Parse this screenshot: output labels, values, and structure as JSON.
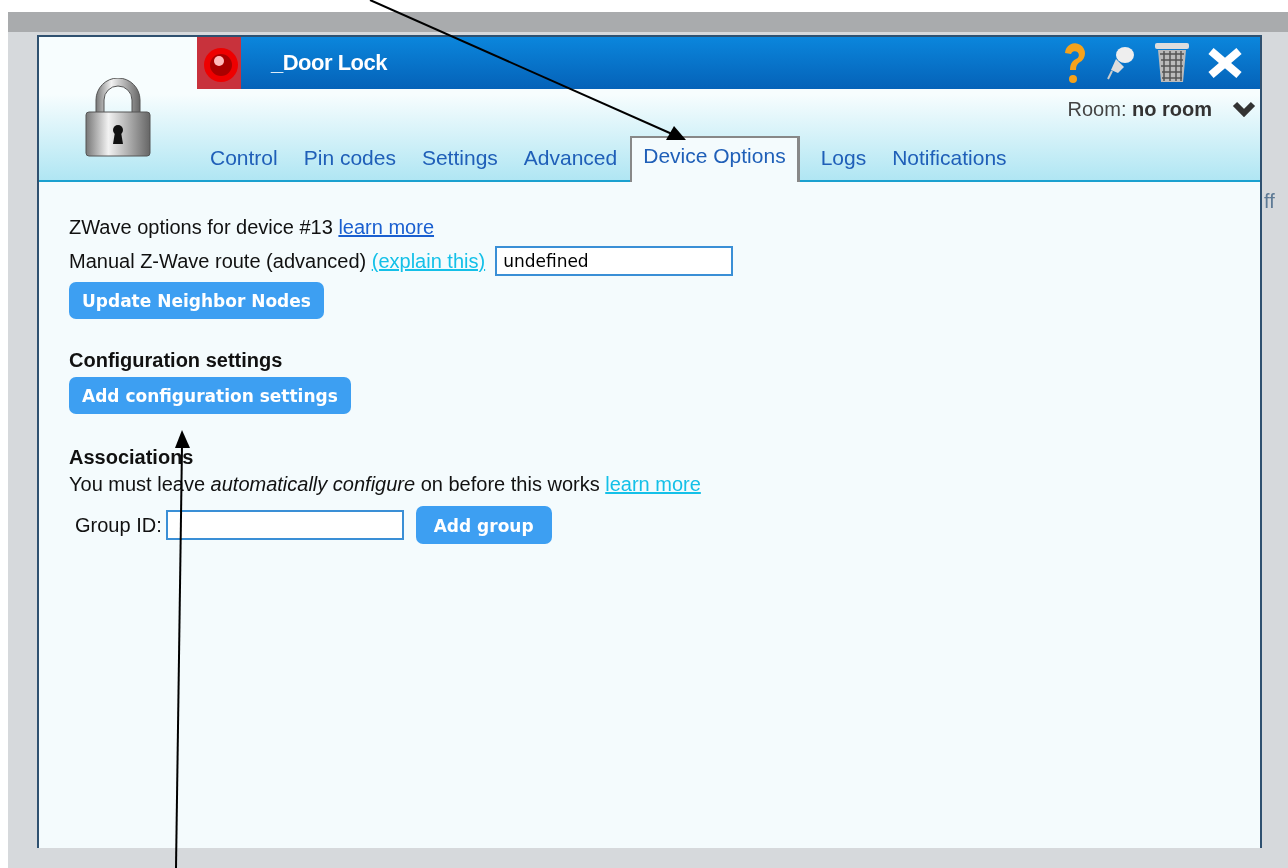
{
  "window": {
    "title": "_Door Lock"
  },
  "room": {
    "label": "Room:",
    "value": "no room"
  },
  "tabs": [
    {
      "label": "Control",
      "selected": false
    },
    {
      "label": "Pin codes",
      "selected": false
    },
    {
      "label": "Settings",
      "selected": false
    },
    {
      "label": "Advanced",
      "selected": false
    },
    {
      "label": "Device Options",
      "selected": true
    },
    {
      "label": "Logs",
      "selected": false
    },
    {
      "label": "Notifications",
      "selected": false
    }
  ],
  "zwave": {
    "text": "ZWave options for device #13",
    "link": "learn more"
  },
  "route": {
    "label": "Manual Z-Wave route (advanced)",
    "link": "(explain this)",
    "value": "undefined"
  },
  "update_button": "Update Neighbor Nodes",
  "configuration": {
    "heading": "Configuration settings",
    "button": "Add configuration settings"
  },
  "associations": {
    "heading": "Associations",
    "text": "You must leave *automatically configure* on before this works",
    "link": "learn more",
    "group_label": "Group ID:",
    "button": "Add group"
  },
  "background": {
    "cut_text": "ff"
  }
}
